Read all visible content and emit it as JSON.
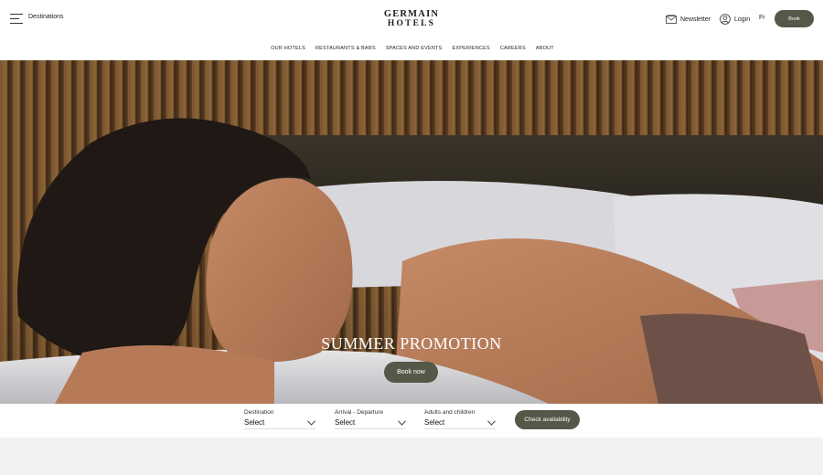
{
  "header": {
    "menu_label": "Destinations",
    "logo_line1": "GERMAIN",
    "logo_line2": "HOTELS",
    "newsletter_label": "Newsletter",
    "login_label": "Login",
    "language_label": "Fr",
    "book_label": "Book"
  },
  "nav": {
    "items": [
      "OUR HOTELS",
      "RESTAURANTS & BARS",
      "SPACES AND EVENTS",
      "EXPERIENCES",
      "CAREERS",
      "ABOUT"
    ]
  },
  "hero": {
    "title": "SUMMER PROMOTION",
    "button_label": "Book now"
  },
  "booking": {
    "fields": [
      {
        "label": "Destination",
        "value": "Select"
      },
      {
        "label": "Arrival - Departure",
        "value": "Select"
      },
      {
        "label": "Adults and children",
        "value": "Select"
      }
    ],
    "check_label": "Check availability"
  },
  "colors": {
    "accent": "#545848",
    "background": "#ffffff",
    "footer_band": "#f2f2f2"
  }
}
